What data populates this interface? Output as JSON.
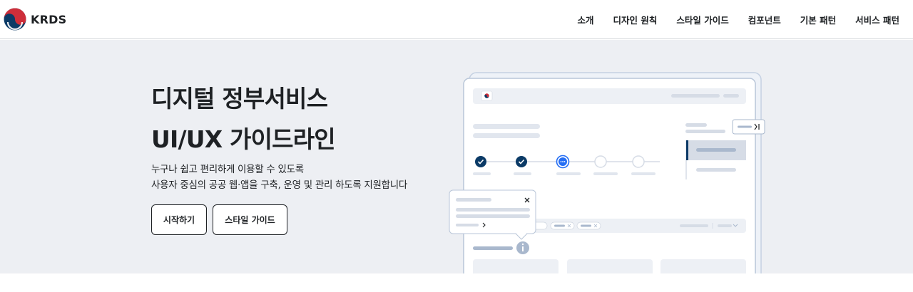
{
  "header": {
    "logo_text": "KRDS",
    "nav": [
      "소개",
      "디자인 원칙",
      "스타일 가이드",
      "컴포넌트",
      "기본 패턴",
      "서비스 패턴"
    ]
  },
  "hero": {
    "title_line1": "디지털 정부서비스",
    "title_line2": "UI/UX 가이드라인",
    "desc_line1": "누구나 쉽고 편리하게 이용할 수 있도록",
    "desc_line2": "사용자 중심의 공공 웹·앱을 구축, 운영 및 관리 하도록 지원합니다",
    "btn_start": "시작하기",
    "btn_guide": "스타일 가이드"
  },
  "illustration": {
    "flag": "🇰🇷",
    "steps_completed": 2,
    "steps_current": 3,
    "steps_total": 5,
    "close_glyph": "✕",
    "collapse_glyph": "›|",
    "info_glyph": "i",
    "chevron_glyph": "›"
  },
  "colors": {
    "primary_dark": "#0b3a66",
    "accent_blue": "#256ef4",
    "hero_bg": "#edeff3",
    "placeholder": "#d6dce6",
    "frame_border": "#b9c6d8"
  }
}
